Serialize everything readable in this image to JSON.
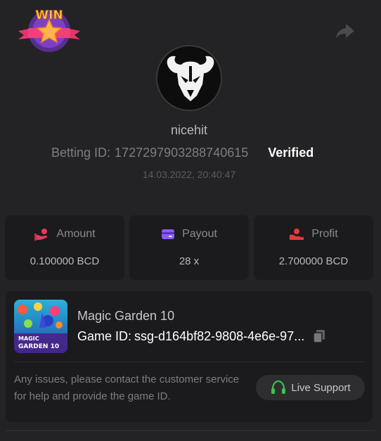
{
  "header": {
    "badge_text": "WIN",
    "share_icon": "share-arrow-icon"
  },
  "profile": {
    "avatar_icon": "bull-skull-avatar",
    "username": "nicehit",
    "betting_label": "Betting ID:",
    "betting_id": "1727297903288740615",
    "verified_label": "Verified",
    "datetime": "14.03.2022, 20:40:47"
  },
  "stats": {
    "amount": {
      "label": "Amount",
      "value": "0.100000 BCD",
      "icon": "hand-coins-icon",
      "color": "#e53b5f"
    },
    "payout": {
      "label": "Payout",
      "value": "28 x",
      "icon": "wallet-card-icon",
      "color": "#8b5cf6"
    },
    "profit": {
      "label": "Profit",
      "value": "2.700000 BCD",
      "icon": "hand-money-icon",
      "color": "#e53b3b"
    }
  },
  "game": {
    "name": "Magic Garden 10",
    "id_label": "Game ID:",
    "id_value": "ssg-d164bf82-9808-4e6e-97...",
    "thumb_text_1": "MAGIC",
    "thumb_text_2": "GARDEN 10",
    "support_text": "Any issues, please contact the customer service for help and provide the game ID.",
    "live_support_label": "Live Support",
    "support_icon_color": "#3fc24a"
  }
}
